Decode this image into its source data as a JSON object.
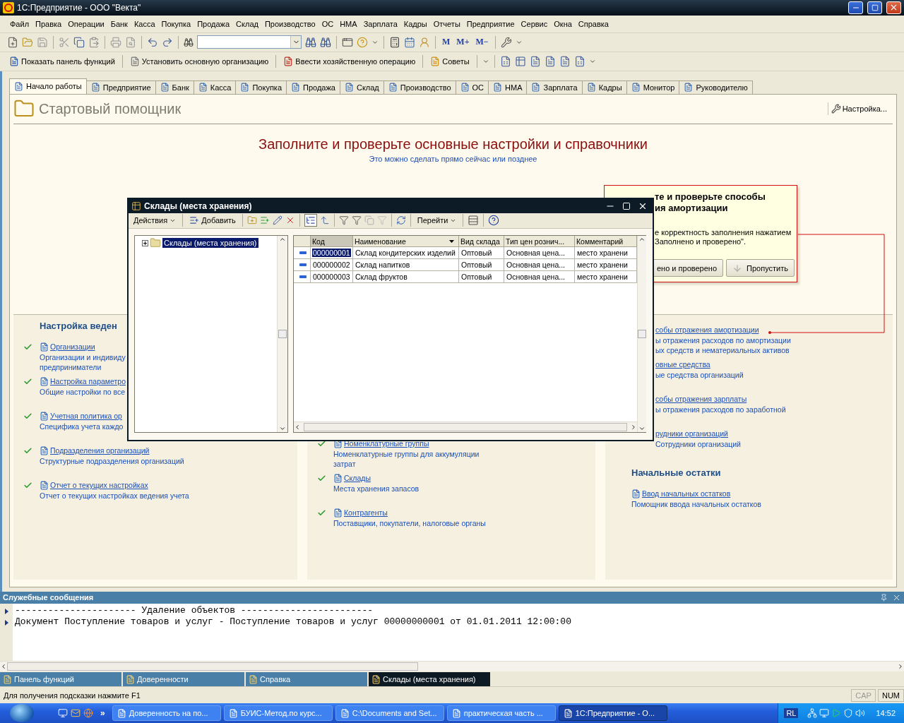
{
  "window": {
    "title": "1С:Предприятие - ООО \"Векта\""
  },
  "menu": [
    "Файл",
    "Правка",
    "Операции",
    "Банк",
    "Касса",
    "Покупка",
    "Продажа",
    "Склад",
    "Производство",
    "ОС",
    "НМА",
    "Зарплата",
    "Кадры",
    "Отчеты",
    "Предприятие",
    "Сервис",
    "Окна",
    "Справка"
  ],
  "toolbar_memory": [
    "M",
    "M+",
    "M−"
  ],
  "toolbar2": [
    "Показать панель функций",
    "Установить основную организацию",
    "Ввести хозяйственную операцию",
    "Советы"
  ],
  "tabs": [
    {
      "label": "Начало работы",
      "selected": true
    },
    {
      "label": "Предприятие",
      "selected": false
    },
    {
      "label": "Банк",
      "selected": false
    },
    {
      "label": "Касса",
      "selected": false
    },
    {
      "label": "Покупка",
      "selected": false
    },
    {
      "label": "Продажа",
      "selected": false
    },
    {
      "label": "Склад",
      "selected": false
    },
    {
      "label": "Производство",
      "selected": false
    },
    {
      "label": "ОС",
      "selected": false
    },
    {
      "label": "НМА",
      "selected": false
    },
    {
      "label": "Зарплата",
      "selected": false
    },
    {
      "label": "Кадры",
      "selected": false
    },
    {
      "label": "Монитор",
      "selected": false
    },
    {
      "label": "Руководителю",
      "selected": false
    }
  ],
  "assistant": {
    "title": "Стартовый помощник",
    "settings": "Настройка...",
    "heading": "Заполните и проверьте основные настройки и справочники",
    "subheading": "Это можно сделать прямо сейчас или позднее"
  },
  "sections": [
    {
      "blocks": [
        {
          "kind": "heading",
          "text": "Настройка веден"
        },
        {
          "kind": "item",
          "done": true,
          "link": "Организации",
          "lines": [
            "Организации и индивиду",
            "предприниматели"
          ]
        },
        {
          "kind": "item",
          "done": true,
          "link": "Настройка параметро",
          "lines": [
            "Общие настройки по все"
          ]
        },
        {
          "kind": "item",
          "done": true,
          "link": "Учетная политика ор",
          "lines": [
            "Специфика учета каждо"
          ]
        },
        {
          "kind": "item",
          "done": true,
          "link": "Подразделения организаций",
          "lines": [
            "Структурные подразделения организаций"
          ]
        },
        {
          "kind": "item",
          "done": true,
          "link": "Отчет о текущих настройках",
          "lines": [
            "Отчет о текущих настройках ведения учета"
          ]
        }
      ]
    },
    {
      "blocks": [
        {
          "kind": "item",
          "done": true,
          "link": "Номенклатурные группы",
          "lines": [
            "Номенклатурные группы для аккумуляции",
            "затрат"
          ]
        },
        {
          "kind": "item",
          "done": true,
          "link": "Склады",
          "lines": [
            "Места хранения запасов"
          ]
        },
        {
          "kind": "item",
          "done": true,
          "link": "Контрагенты",
          "lines": [
            "Поставщики, покупатели, налоговые органы"
          ]
        }
      ]
    },
    {
      "blocks": [
        {
          "kind": "partial",
          "done": false,
          "link": "собы отражения амортизации",
          "lines": [
            "ы отражения расходов по амортизации",
            "ых средств и нематериальных активов"
          ]
        },
        {
          "kind": "partial",
          "done": false,
          "link": "овные средства",
          "lines": [
            "ые средства организаций"
          ]
        },
        {
          "kind": "partial",
          "done": false,
          "link": "собы отражения зарплаты",
          "lines": [
            "ы отражения расходов по заработной"
          ]
        },
        {
          "kind": "partial",
          "done": false,
          "link": "рудники организаций",
          "lines": [
            "Сотрудники организаций"
          ]
        },
        {
          "kind": "heading",
          "text": "Начальные остатки"
        },
        {
          "kind": "item",
          "done": false,
          "link": "Ввод начальных остатков",
          "lines": [
            "Помощник ввода начальных остатков"
          ]
        }
      ]
    }
  ],
  "popup": {
    "title": [
      "те и проверьте способы",
      "ия амортизации"
    ],
    "text": [
      "е корректность заполнения нажатием",
      "Заполнено и проверено\"."
    ],
    "buttons": [
      "ено и проверено",
      "Пропустить"
    ]
  },
  "dialog": {
    "title": "Склады (места хранения)",
    "actions": "Действия",
    "add": "Добавить",
    "goto": "Перейти",
    "hierarchy_on": true,
    "tree": [
      {
        "label": "Склады (места хранения)",
        "selected": true,
        "expanded": false
      }
    ],
    "columns": [
      "Код",
      "Наименование",
      "Вид склада",
      "Тип цен рознич...",
      "Комментарий"
    ],
    "rows": [
      {
        "selected": true,
        "cells": [
          "000000001",
          "Склад кондитерских изделий",
          "Оптовый",
          "Основная цена...",
          "место хранени"
        ]
      },
      {
        "selected": false,
        "cells": [
          "000000002",
          "Склад напитков",
          "Оптовый",
          "Основная цена...",
          "место хранени"
        ]
      },
      {
        "selected": false,
        "cells": [
          "000000003",
          "Склад фруктов",
          "Оптовый",
          "Основная цена...",
          "место хранени"
        ]
      }
    ]
  },
  "messages": {
    "title": "Служебные сообщения",
    "lines": [
      "---------------------- Удаление объектов ------------------------",
      "Документ Поступление товаров и услуг - Поступление товаров и услуг 00000000001 от 01.01.2011 12:00:00"
    ]
  },
  "window_tabs": [
    {
      "label": "Панель функций",
      "selected": false
    },
    {
      "label": "Доверенности",
      "selected": false
    },
    {
      "label": "Справка",
      "selected": false
    },
    {
      "label": "Склады (места хранения)",
      "selected": true
    }
  ],
  "status": {
    "hint": "Для получения подсказки нажмите F1",
    "indicators": [
      {
        "label": "CAP",
        "on": false
      },
      {
        "label": "NUM",
        "on": true
      }
    ]
  },
  "taskbar": {
    "more": "»",
    "items": [
      {
        "label": "Доверенность на по...",
        "selected": false
      },
      {
        "label": "БУИС-Метод.по курс...",
        "selected": false
      },
      {
        "label": "C:\\Documents and Set...",
        "selected": false
      },
      {
        "label": "практическая часть ...",
        "selected": false
      },
      {
        "label": "1С:Предприятие - О...",
        "selected": true
      }
    ],
    "lang": "RL",
    "clock": "14:52"
  }
}
